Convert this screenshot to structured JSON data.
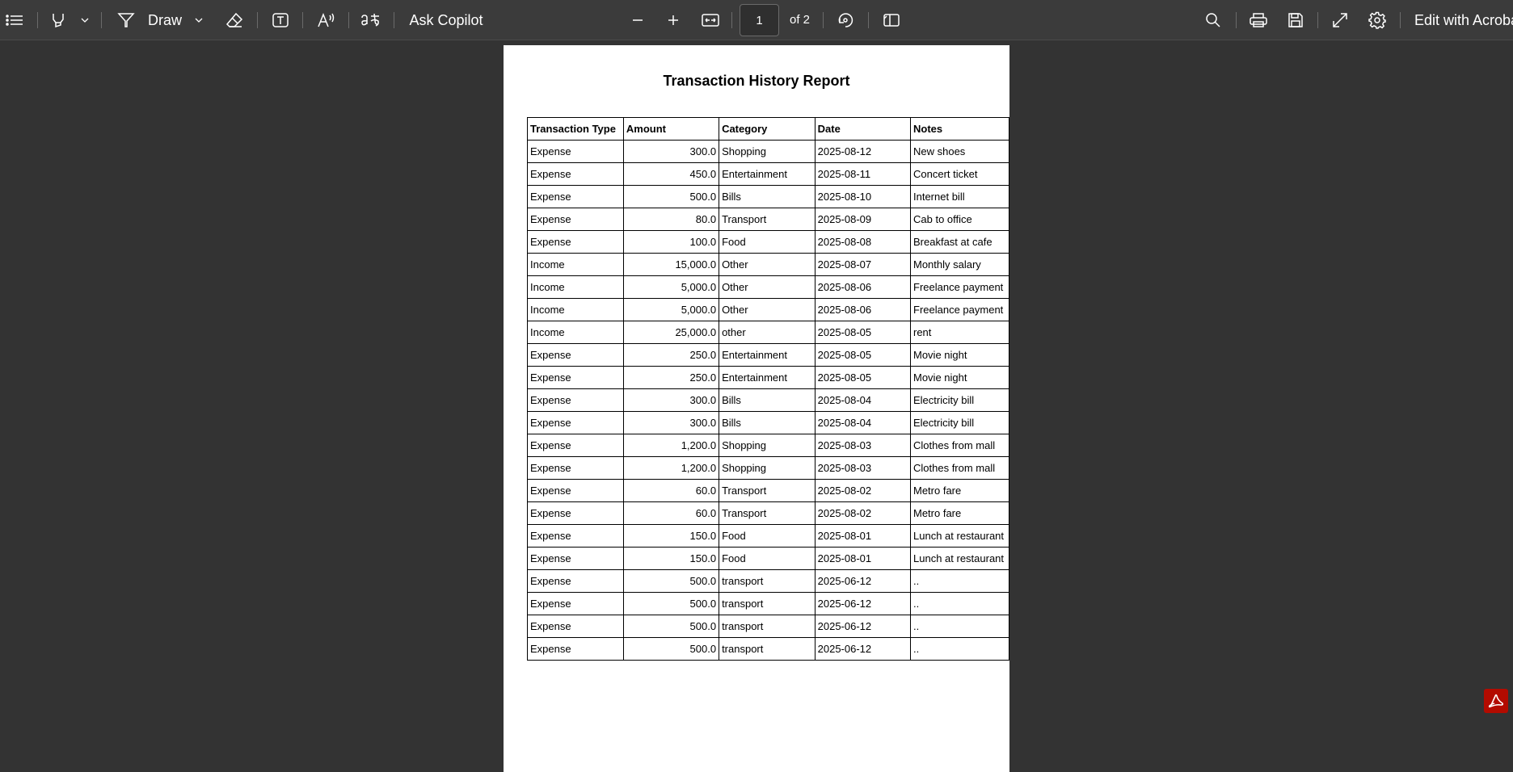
{
  "toolbar": {
    "draw_label": "Draw",
    "ask_copilot_label": "Ask Copilot",
    "page_number": "1",
    "page_of": "of 2",
    "edit_label": "Edit with Acrobat",
    "icons": [
      "contents-icon",
      "highlight-icon",
      "draw-icon",
      "erase-icon",
      "text-box-icon",
      "read-aloud-icon",
      "translate-icon",
      "zoom-out-icon",
      "zoom-in-icon",
      "fit-page-icon",
      "rotate-icon",
      "page-view-icon",
      "search-icon",
      "print-icon",
      "save-icon",
      "fullscreen-icon",
      "settings-icon"
    ]
  },
  "report": {
    "title": "Transaction History Report",
    "columns": [
      "Transaction Type",
      "Amount",
      "Category",
      "Date",
      "Notes"
    ],
    "rows": [
      [
        "Expense",
        "300.0",
        "Shopping",
        "2025-08-12",
        "New shoes"
      ],
      [
        "Expense",
        "450.0",
        "Entertainment",
        "2025-08-11",
        "Concert ticket"
      ],
      [
        "Expense",
        "500.0",
        "Bills",
        "2025-08-10",
        "Internet bill"
      ],
      [
        "Expense",
        "80.0",
        "Transport",
        "2025-08-09",
        "Cab to office"
      ],
      [
        "Expense",
        "100.0",
        "Food",
        "2025-08-08",
        "Breakfast at cafe"
      ],
      [
        "Income",
        "15,000.0",
        "Other",
        "2025-08-07",
        "Monthly salary"
      ],
      [
        "Income",
        "5,000.0",
        "Other",
        "2025-08-06",
        "Freelance payment"
      ],
      [
        "Income",
        "5,000.0",
        "Other",
        "2025-08-06",
        "Freelance payment"
      ],
      [
        "Income",
        "25,000.0",
        "other",
        "2025-08-05",
        "rent"
      ],
      [
        "Expense",
        "250.0",
        "Entertainment",
        "2025-08-05",
        "Movie night"
      ],
      [
        "Expense",
        "250.0",
        "Entertainment",
        "2025-08-05",
        "Movie night"
      ],
      [
        "Expense",
        "300.0",
        "Bills",
        "2025-08-04",
        "Electricity bill"
      ],
      [
        "Expense",
        "300.0",
        "Bills",
        "2025-08-04",
        "Electricity bill"
      ],
      [
        "Expense",
        "1,200.0",
        "Shopping",
        "2025-08-03",
        "Clothes from mall"
      ],
      [
        "Expense",
        "1,200.0",
        "Shopping",
        "2025-08-03",
        "Clothes from mall"
      ],
      [
        "Expense",
        "60.0",
        "Transport",
        "2025-08-02",
        "Metro fare"
      ],
      [
        "Expense",
        "60.0",
        "Transport",
        "2025-08-02",
        "Metro fare"
      ],
      [
        "Expense",
        "150.0",
        "Food",
        "2025-08-01",
        "Lunch at restaurant"
      ],
      [
        "Expense",
        "150.0",
        "Food",
        "2025-08-01",
        "Lunch at restaurant"
      ],
      [
        "Expense",
        "500.0",
        "transport",
        "2025-06-12",
        ".."
      ],
      [
        "Expense",
        "500.0",
        "transport",
        "2025-06-12",
        ".."
      ],
      [
        "Expense",
        "500.0",
        "transport",
        "2025-06-12",
        ".."
      ],
      [
        "Expense",
        "500.0",
        "transport",
        "2025-06-12",
        ".."
      ]
    ]
  },
  "colors": {
    "toolbar_bg": "#3b3b3b",
    "viewer_bg": "#333333",
    "acrobat_red": "#b30b00"
  }
}
